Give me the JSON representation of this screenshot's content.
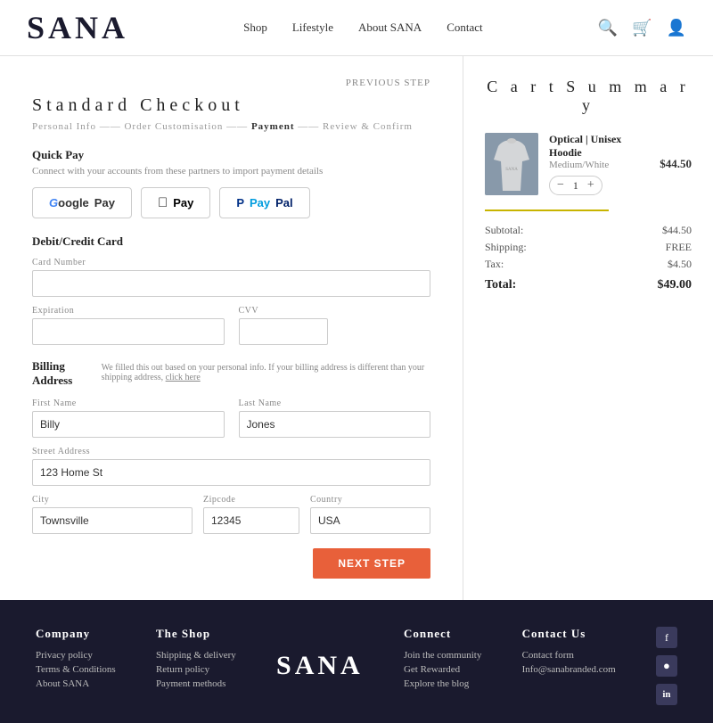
{
  "header": {
    "logo": "SANA",
    "nav": [
      {
        "label": "Shop",
        "id": "nav-shop"
      },
      {
        "label": "Lifestyle",
        "id": "nav-lifestyle"
      },
      {
        "label": "About SANA",
        "id": "nav-about"
      },
      {
        "label": "Contact",
        "id": "nav-contact"
      }
    ]
  },
  "checkout": {
    "previous_step_label": "PREVIOUS STEP",
    "title": "S t a n d a r d   C h e c k o u t",
    "steps": "Personal Info —— Order Customisation —— Payment —— Review & Confirm",
    "quick_pay": {
      "title": "Quick Pay",
      "subtitle": "Connect with your accounts from these partners to import payment details",
      "buttons": [
        {
          "label": "G Pay",
          "type": "gpay"
        },
        {
          "label": " Pay",
          "type": "apple"
        },
        {
          "label": "PayPal",
          "type": "paypal"
        }
      ]
    },
    "debit_credit": {
      "title": "Debit/Credit Card",
      "card_number_label": "Card Number",
      "card_number_value": "",
      "expiration_label": "Expiration",
      "expiration_value": "",
      "cvv_label": "CVV",
      "cvv_value": ""
    },
    "billing": {
      "title": "Billing Address",
      "note": "We filled this out based on your personal info. If your billing address is different than your shipping address,",
      "note_link": "click here",
      "first_name_label": "First Name",
      "first_name_value": "Billy",
      "last_name_label": "Last Name",
      "last_name_value": "Jones",
      "street_label": "Street Address",
      "street_value": "123 Home St",
      "city_label": "City",
      "city_value": "Townsville",
      "zip_label": "Zipcode",
      "zip_value": "12345",
      "country_label": "Country",
      "country_value": "USA"
    },
    "next_step_label": "NEXT STEP"
  },
  "cart": {
    "title": "C a r t   S u m m a r y",
    "item": {
      "name": "Optical | Unisex Hoodie",
      "variant": "Medium/White",
      "quantity": 1,
      "price": "$44.50"
    },
    "subtotal_label": "Subtotal:",
    "subtotal_value": "$44.50",
    "shipping_label": "Shipping:",
    "shipping_value": "FREE",
    "tax_label": "Tax:",
    "tax_value": "$4.50",
    "total_label": "Total:",
    "total_value": "$49.00"
  },
  "footer": {
    "logo": "SANA",
    "columns": [
      {
        "title": "Company",
        "links": [
          "Privacy policy",
          "Terms & Conditions",
          "About SANA"
        ]
      },
      {
        "title": "The Shop",
        "links": [
          "Shipping & delivery",
          "Return policy",
          "Payment methods"
        ]
      },
      {
        "title": "Connect",
        "links": [
          "Join the community",
          "Get Rewarded",
          "Explore the blog"
        ]
      },
      {
        "title": "Contact Us",
        "links": [
          "Contact form",
          "Info@sanabranded.com"
        ]
      }
    ],
    "social": [
      "f",
      "📷",
      "in"
    ]
  }
}
